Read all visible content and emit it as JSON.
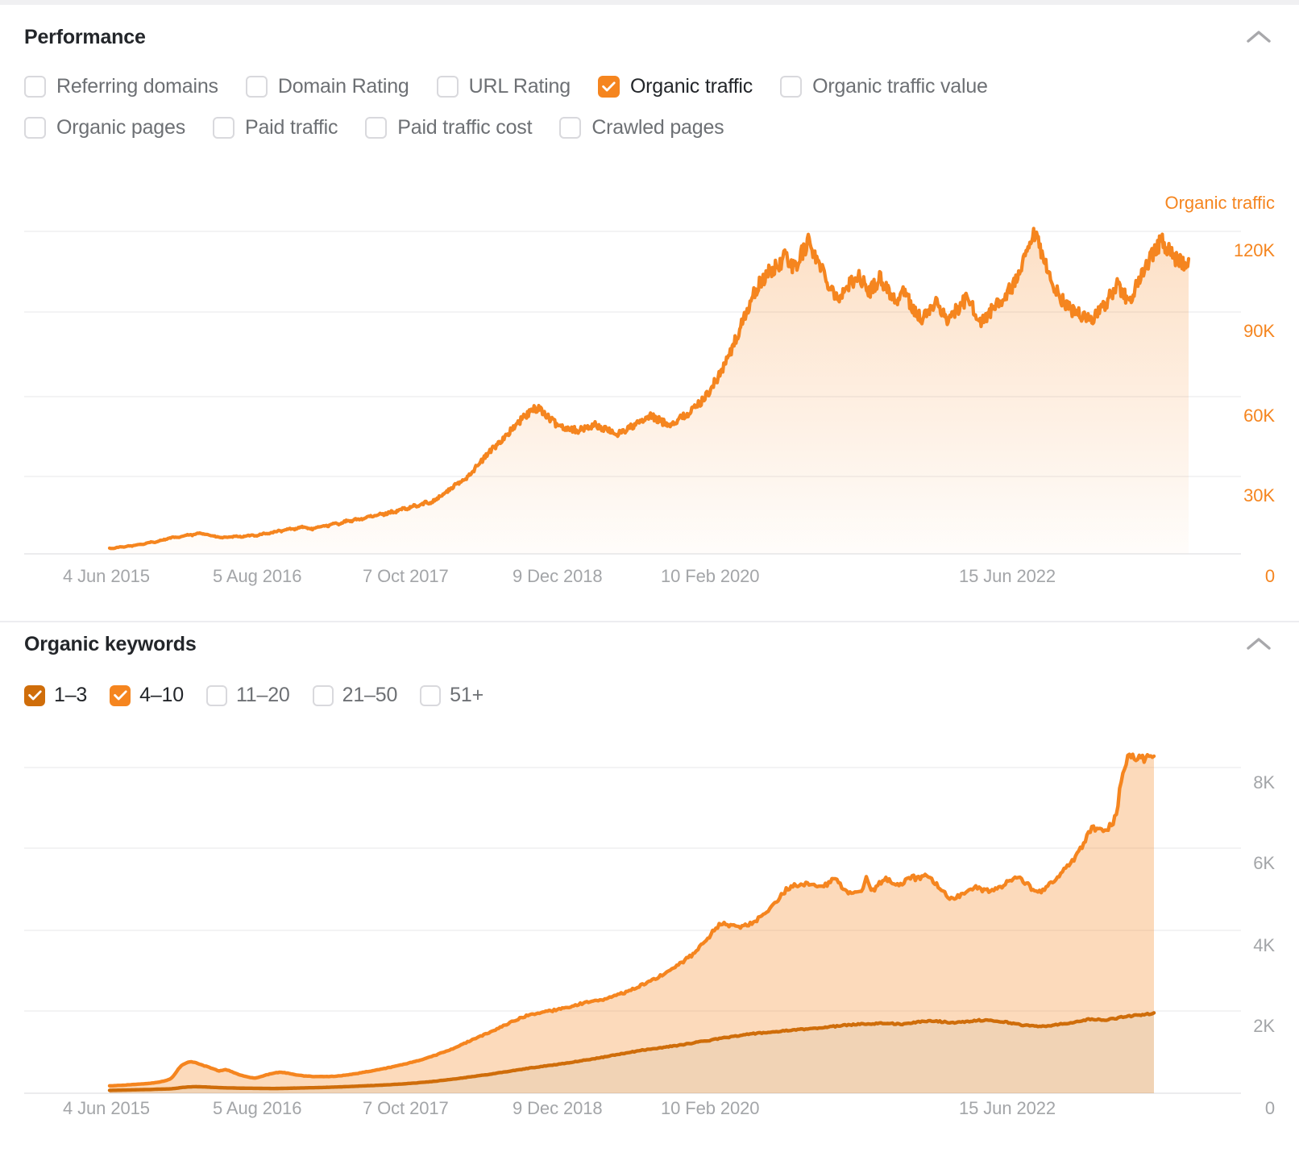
{
  "performance": {
    "title": "Performance",
    "collapse_icon": "chevron-up-icon",
    "metrics": [
      {
        "label": "Referring domains",
        "checked": false
      },
      {
        "label": "Domain Rating",
        "checked": false
      },
      {
        "label": "URL Rating",
        "checked": false
      },
      {
        "label": "Organic traffic",
        "checked": true
      },
      {
        "label": "Organic traffic value",
        "checked": false
      },
      {
        "label": "Organic pages",
        "checked": false
      },
      {
        "label": "Paid traffic",
        "checked": false
      },
      {
        "label": "Paid traffic cost",
        "checked": false
      },
      {
        "label": "Crawled pages",
        "checked": false
      }
    ],
    "series_title": "Organic traffic"
  },
  "organic_keywords": {
    "title": "Organic keywords",
    "collapse_icon": "chevron-up-icon",
    "buckets": [
      {
        "label": "1–3",
        "checked": true,
        "color": "#cf6d0a"
      },
      {
        "label": "4–10",
        "checked": true,
        "color": "#f5851f"
      },
      {
        "label": "11–20",
        "checked": false,
        "color": "#f5851f"
      },
      {
        "label": "21–50",
        "checked": false,
        "color": "#f5851f"
      },
      {
        "label": "51+",
        "checked": false,
        "color": "#f5851f"
      }
    ]
  },
  "colors": {
    "accent": "#f5851f",
    "accent_dark": "#cf6d0a",
    "grid": "#ededf0",
    "text_muted": "#a3a5a8",
    "text_dark": "#23262a"
  },
  "chart_data": [
    {
      "type": "area",
      "name": "organic-traffic-chart",
      "title": "Organic traffic",
      "xlabel": "",
      "ylabel": "Organic traffic",
      "ylim": [
        0,
        150000
      ],
      "ytick_labels": [
        "120K",
        "90K",
        "60K",
        "30K",
        "0"
      ],
      "ytick_values": [
        120000,
        90000,
        60000,
        30000,
        0
      ],
      "xtick_labels": [
        "4 Jun 2015",
        "5 Aug 2016",
        "7 Oct 2017",
        "9 Dec 2018",
        "10 Feb 2020",
        "15 Jun 2022"
      ],
      "grid": true,
      "legend": "right",
      "line_color": "#f5851f",
      "series": [
        {
          "name": "Organic traffic",
          "values": [
            2100,
            2000,
            2400,
            2600,
            2500,
            3000,
            2900,
            3300,
            3600,
            3500,
            4100,
            4400,
            4200,
            4800,
            5200,
            5400,
            5900,
            6200,
            6000,
            6400,
            6800,
            7100,
            6900,
            7400,
            7800,
            7500,
            7200,
            6800,
            6500,
            6200,
            6000,
            6300,
            6100,
            6400,
            6600,
            6300,
            6500,
            6800,
            7000,
            6700,
            7200,
            7600,
            7400,
            7900,
            8200,
            8600,
            8400,
            9000,
            9400,
            9100,
            9600,
            10100,
            9800,
            9500,
            9200,
            9600,
            10200,
            10600,
            10300,
            10900,
            11400,
            11100,
            11700,
            12300,
            12000,
            12600,
            13100,
            12800,
            13400,
            14000,
            13700,
            14300,
            14900,
            14600,
            15200,
            15800,
            15500,
            16200,
            16900,
            16500,
            17200,
            18000,
            17600,
            18400,
            19200,
            18800,
            19700,
            20600,
            21500,
            22400,
            23400,
            24500,
            25600,
            26400,
            27200,
            28600,
            30100,
            31500,
            33000,
            34600,
            36200,
            37900,
            39200,
            40600,
            42100,
            43500,
            44800,
            46200,
            47600,
            49100,
            50600,
            51800,
            52900,
            53800,
            54500,
            53200,
            51800,
            50300,
            49100,
            48200,
            47600,
            47100,
            46800,
            46500,
            46200,
            45900,
            46400,
            47000,
            47600,
            48100,
            47400,
            46800,
            46200,
            45600,
            45100,
            44700,
            45300,
            46000,
            46700,
            47400,
            48100,
            48900,
            49600,
            50400,
            51200,
            50500,
            49800,
            49200,
            48700,
            48200,
            48900,
            49700,
            50600,
            51500,
            52400,
            53500,
            54800,
            56200,
            57800,
            59600,
            61600,
            63800,
            66200,
            68800,
            71600,
            74600,
            77800,
            81200,
            84800,
            88600,
            92200,
            95400,
            98200,
            100600,
            102600,
            104200,
            105400,
            106200,
            107800,
            109400,
            111000,
            108600,
            106200,
            108800,
            111400,
            114000,
            116600,
            113200,
            110000,
            107000,
            104200,
            101600,
            99200,
            97000,
            95000,
            96800,
            98600,
            100400,
            102200,
            104000,
            101800,
            99600,
            97400,
            99200,
            101000,
            102800,
            100600,
            98400,
            96200,
            94000,
            95800,
            97600,
            95400,
            93200,
            91000,
            89000,
            87200,
            88800,
            90400,
            92000,
            93600,
            91400,
            89200,
            87000,
            88600,
            90200,
            91800,
            93400,
            95000,
            92800,
            90600,
            88400,
            86200,
            87800,
            89400,
            91000,
            92600,
            94200,
            95800,
            97400,
            99000,
            101200,
            104000,
            107600,
            111600,
            115200,
            118600,
            115200,
            111000,
            107000,
            103400,
            100200,
            97400,
            95200,
            93400,
            92000,
            90800,
            89800,
            89000,
            88400,
            88000,
            87600,
            88400,
            89600,
            91200,
            93200,
            95600,
            98200,
            100400,
            98200,
            96000,
            94200,
            96400,
            99000,
            101800,
            104600,
            107400,
            110200,
            112600,
            114800,
            116600,
            114400,
            112200,
            110600,
            109400,
            108600,
            108000,
            107600
          ]
        }
      ]
    },
    {
      "type": "area",
      "name": "organic-keywords-chart",
      "title": "Organic keywords",
      "xlabel": "",
      "ylabel": "",
      "ylim": [
        0,
        9000
      ],
      "ytick_labels": [
        "8K",
        "6K",
        "4K",
        "2K",
        "0"
      ],
      "ytick_values": [
        8000,
        6000,
        4000,
        2000,
        0
      ],
      "xtick_labels": [
        "4 Jun 2015",
        "5 Aug 2016",
        "7 Oct 2017",
        "9 Dec 2018",
        "10 Feb 2020",
        "15 Jun 2022"
      ],
      "grid": true,
      "stacked": true,
      "series": [
        {
          "name": "1–3",
          "color": "#cf6d0a",
          "values": [
            70,
            72,
            74,
            75,
            78,
            80,
            82,
            84,
            86,
            88,
            90,
            92,
            95,
            98,
            100,
            103,
            106,
            110,
            118,
            130,
            142,
            150,
            155,
            158,
            160,
            158,
            155,
            150,
            146,
            142,
            138,
            135,
            132,
            130,
            128,
            126,
            125,
            124,
            123,
            122,
            120,
            119,
            118,
            117,
            116,
            115,
            116,
            118,
            120,
            122,
            124,
            126,
            128,
            130,
            132,
            134,
            136,
            138,
            140,
            143,
            146,
            149,
            152,
            155,
            158,
            161,
            164,
            168,
            172,
            176,
            180,
            184,
            188,
            192,
            196,
            200,
            205,
            210,
            215,
            220,
            226,
            232,
            238,
            244,
            250,
            258,
            266,
            274,
            282,
            290,
            300,
            310,
            320,
            330,
            340,
            352,
            364,
            376,
            388,
            400,
            412,
            424,
            436,
            448,
            460,
            472,
            486,
            500,
            514,
            528,
            542,
            556,
            570,
            584,
            598,
            612,
            624,
            636,
            648,
            660,
            672,
            684,
            696,
            708,
            720,
            734,
            748,
            762,
            776,
            790,
            804,
            818,
            832,
            846,
            860,
            876,
            892,
            908,
            924,
            940,
            956,
            972,
            988,
            1004,
            1020,
            1036,
            1052,
            1066,
            1078,
            1090,
            1100,
            1112,
            1124,
            1136,
            1148,
            1160,
            1174,
            1188,
            1202,
            1216,
            1230,
            1244,
            1258,
            1272,
            1286,
            1300,
            1316,
            1332,
            1348,
            1362,
            1376,
            1390,
            1404,
            1418,
            1430,
            1442,
            1452,
            1462,
            1470,
            1478,
            1486,
            1494,
            1502,
            1510,
            1518,
            1526,
            1534,
            1542,
            1550,
            1558,
            1566,
            1574,
            1582,
            1590,
            1598,
            1606,
            1614,
            1622,
            1630,
            1640,
            1650,
            1660,
            1668,
            1676,
            1684,
            1690,
            1696,
            1700,
            1704,
            1708,
            1712,
            1716,
            1720,
            1716,
            1712,
            1708,
            1704,
            1700,
            1696,
            1700,
            1712,
            1730,
            1748,
            1760,
            1768,
            1774,
            1778,
            1770,
            1762,
            1754,
            1748,
            1742,
            1738,
            1734,
            1740,
            1752,
            1764,
            1776,
            1784,
            1790,
            1794,
            1790,
            1784,
            1778,
            1770,
            1760,
            1748,
            1736,
            1722,
            1706,
            1690,
            1676,
            1664,
            1654,
            1648,
            1644,
            1646,
            1652,
            1660,
            1668,
            1678,
            1690,
            1704,
            1718,
            1732,
            1748,
            1764,
            1780,
            1796,
            1812,
            1820,
            1812,
            1804,
            1798,
            1806,
            1818,
            1832,
            1848,
            1864,
            1878,
            1890,
            1900,
            1910,
            1920,
            1930,
            1940,
            1948,
            1955
          ]
        },
        {
          "name": "4–10",
          "color": "#f5851f",
          "values": [
            110,
            112,
            115,
            118,
            120,
            124,
            128,
            132,
            136,
            140,
            145,
            150,
            158,
            168,
            180,
            196,
            218,
            260,
            360,
            480,
            560,
            600,
            620,
            600,
            575,
            545,
            520,
            500,
            470,
            440,
            410,
            430,
            450,
            420,
            385,
            350,
            320,
            295,
            275,
            260,
            250,
            270,
            300,
            330,
            355,
            375,
            390,
            395,
            385,
            370,
            350,
            330,
            315,
            300,
            290,
            282,
            276,
            272,
            270,
            268,
            266,
            264,
            266,
            270,
            276,
            284,
            292,
            302,
            312,
            324,
            336,
            348,
            360,
            372,
            384,
            396,
            410,
            424,
            438,
            452,
            466,
            482,
            498,
            514,
            530,
            548,
            566,
            584,
            604,
            624,
            646,
            668,
            692,
            716,
            742,
            768,
            796,
            824,
            852,
            880,
            908,
            936,
            964,
            992,
            1020,
            1048,
            1076,
            1104,
            1132,
            1160,
            1188,
            1216,
            1242,
            1266,
            1286,
            1302,
            1314,
            1322,
            1328,
            1332,
            1334,
            1336,
            1340,
            1346,
            1354,
            1362,
            1372,
            1382,
            1392,
            1400,
            1406,
            1410,
            1412,
            1414,
            1416,
            1420,
            1426,
            1434,
            1444,
            1456,
            1470,
            1486,
            1504,
            1524,
            1546,
            1570,
            1596,
            1624,
            1654,
            1686,
            1720,
            1756,
            1794,
            1834,
            1876,
            1920,
            1966,
            2014,
            2064,
            2116,
            2170,
            2230,
            2300,
            2380,
            2470,
            2570,
            2680,
            2760,
            2800,
            2790,
            2760,
            2730,
            2700,
            2680,
            2670,
            2680,
            2700,
            2740,
            2790,
            2850,
            2920,
            3000,
            3090,
            3190,
            3290,
            3380,
            3450,
            3500,
            3530,
            3550,
            3560,
            3555,
            3540,
            3520,
            3500,
            3480,
            3460,
            3500,
            3560,
            3600,
            3570,
            3450,
            3330,
            3260,
            3240,
            3250,
            3260,
            3270,
            3600,
            3300,
            3280,
            3440,
            3420,
            3560,
            3530,
            3480,
            3440,
            3420,
            3460,
            3540,
            3600,
            3560,
            3520,
            3550,
            3580,
            3530,
            3480,
            3400,
            3300,
            3200,
            3120,
            3080,
            3060,
            3080,
            3120,
            3180,
            3230,
            3270,
            3300,
            3260,
            3200,
            3180,
            3200,
            3240,
            3280,
            3320,
            3380,
            3440,
            3500,
            3560,
            3600,
            3560,
            3480,
            3400,
            3320,
            3280,
            3300,
            3360,
            3440,
            3520,
            3600,
            3680,
            3760,
            3840,
            3920,
            4000,
            4120,
            4250,
            4400,
            4550,
            4700,
            4680,
            4650,
            4660,
            4700,
            4760,
            4840,
            5200,
            5800,
            6200,
            6400,
            6380,
            6340,
            6320,
            6300,
            6290,
            6280,
            6275
          ]
        }
      ]
    }
  ]
}
